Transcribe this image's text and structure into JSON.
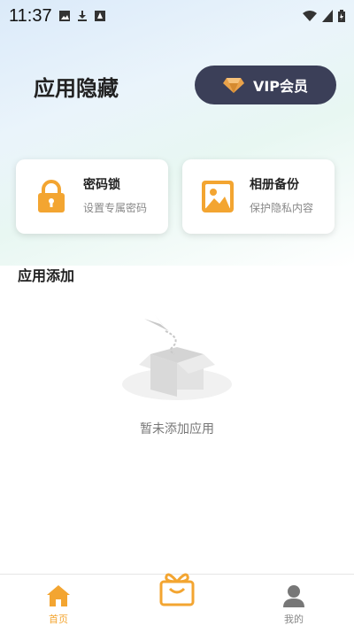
{
  "status_bar": {
    "time": "11:37"
  },
  "header": {
    "title": "应用隐藏",
    "vip_label": "VIP会员"
  },
  "cards": [
    {
      "title": "密码锁",
      "subtitle": "设置专属密码",
      "icon": "lock-icon"
    },
    {
      "title": "相册备份",
      "subtitle": "保护隐私内容",
      "icon": "image-icon"
    }
  ],
  "section": {
    "title": "应用添加"
  },
  "empty_state": {
    "text": "暂未添加应用"
  },
  "bottom_nav": {
    "items": [
      {
        "label": "首页",
        "icon": "home-icon",
        "active": true
      },
      {
        "label": "",
        "icon": "gift-icon"
      },
      {
        "label": "我的",
        "icon": "user-icon"
      }
    ]
  },
  "colors": {
    "accent": "#f3a531",
    "vip_bg": "#3b3f58",
    "vip_diamond": "#e9a24a"
  }
}
